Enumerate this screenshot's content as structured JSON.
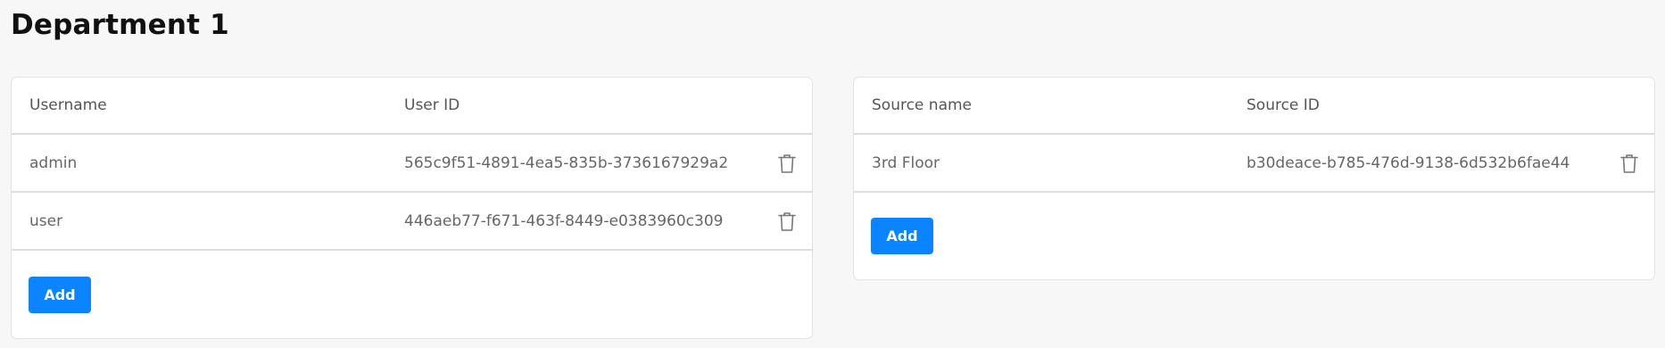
{
  "page": {
    "title": "Department 1"
  },
  "users_table": {
    "headers": [
      "Username",
      "User ID"
    ],
    "rows": [
      {
        "username": "admin",
        "user_id": "565c9f51-4891-4ea5-835b-3736167929a2"
      },
      {
        "username": "user",
        "user_id": "446aeb77-f671-463f-8449-e0383960c309"
      }
    ],
    "add_label": "Add"
  },
  "sources_table": {
    "headers": [
      "Source name",
      "Source ID"
    ],
    "rows": [
      {
        "source_name": "3rd Floor",
        "source_id": "b30deace-b785-476d-9138-6d532b6fae44"
      }
    ],
    "add_label": "Add"
  },
  "icons": {
    "delete": "trash-icon"
  },
  "colors": {
    "accent": "#0a84ff",
    "background": "#f7f7f7",
    "card": "#ffffff",
    "divider": "#dedede"
  }
}
